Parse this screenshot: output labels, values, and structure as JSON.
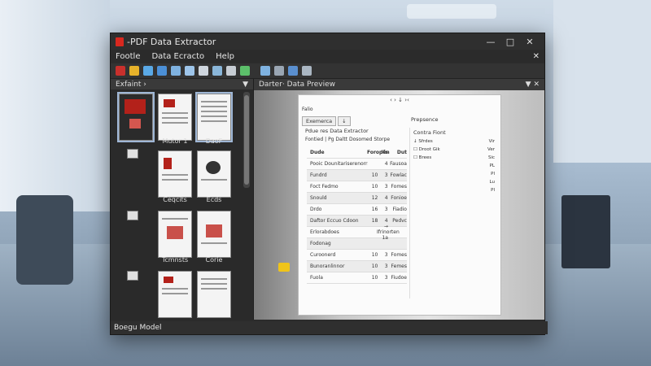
{
  "app": {
    "title": "-PDF Data Extractor",
    "accent": "#d9281f"
  },
  "window_controls": {
    "minimize": "—",
    "maximize": "□",
    "close": "✕"
  },
  "menu": {
    "items": [
      "Footle",
      "Data Ecracto",
      "Help"
    ],
    "close": "✕"
  },
  "left_panel": {
    "title": "Exfaint ›",
    "tiles": [
      {
        "label": ""
      },
      {
        "label": "Mutor 1"
      },
      {
        "label": "DaoF"
      },
      {
        "label": "Ceqcits"
      },
      {
        "label": "Ecds"
      },
      {
        "label": "Tcmnsts"
      },
      {
        "label": "Corie"
      },
      {
        "label": ""
      },
      {
        "label": ""
      }
    ]
  },
  "preview_panel": {
    "tab": "Darter· Data Preview",
    "doc_title": "Falio",
    "toolbar_glyphs": "‹  ›  ↓  ›‹",
    "tabs": [
      "Exemerca",
      "↓"
    ],
    "side_title": "Prepsence",
    "header": "Pdue res Data Extractor",
    "subheader": "Fontied  | Pg  Daltt Dosomed Storpe",
    "columns": [
      "Dude",
      "Foropen",
      "Ifs",
      "Dut"
    ],
    "rows": [
      {
        "name": "Pooic Dounitariserenorrst",
        "v1": "",
        "v2": "4",
        "v3": "Fausoa"
      },
      {
        "name": "Fundrd",
        "v1": "10",
        "v2": "3",
        "v3": "Fowlac"
      },
      {
        "name": "Foct Fedmo",
        "v1": "10",
        "v2": "3",
        "v3": "Fomes"
      },
      {
        "name": "Snould",
        "v1": "12",
        "v2": "4",
        "v3": "Fonioe"
      },
      {
        "name": "Drdo",
        "v1": "16",
        "v2": "3",
        "v3": "Fiadio"
      },
      {
        "name": "Daftor Eccuo Cdoon",
        "v1": "18",
        "v2": "4",
        "v3": "Pedvc"
      },
      {
        "name": "Erlorabdoes",
        "v1": "",
        "v2": "→ Ifrinorten 1a",
        "v3": ""
      },
      {
        "name": "Fodonag",
        "v1": "",
        "v2": "",
        "v3": ""
      },
      {
        "name": "Curoonerd",
        "v1": "10",
        "v2": "3",
        "v3": "Fomes"
      },
      {
        "name": "Bunoranlinnor",
        "v1": "10",
        "v2": "3",
        "v3": "Femes"
      },
      {
        "name": "Fuola",
        "v1": "10",
        "v2": "3",
        "v3": "Fiudoe"
      }
    ],
    "side_section": "Contra Fiont",
    "side_rows": [
      {
        "k": "↓ Sfrdes",
        "v": "Vir"
      },
      {
        "k": "☐ Droot Gik",
        "v": "Ver"
      },
      {
        "k": "☐ Brees",
        "v": "Sic"
      },
      {
        "k": "",
        "v": "PL"
      },
      {
        "k": "",
        "v": "Pl"
      },
      {
        "k": "",
        "v": "Lu"
      },
      {
        "k": "",
        "v": "Pl"
      }
    ]
  },
  "status": {
    "text": "Boegu Model"
  }
}
